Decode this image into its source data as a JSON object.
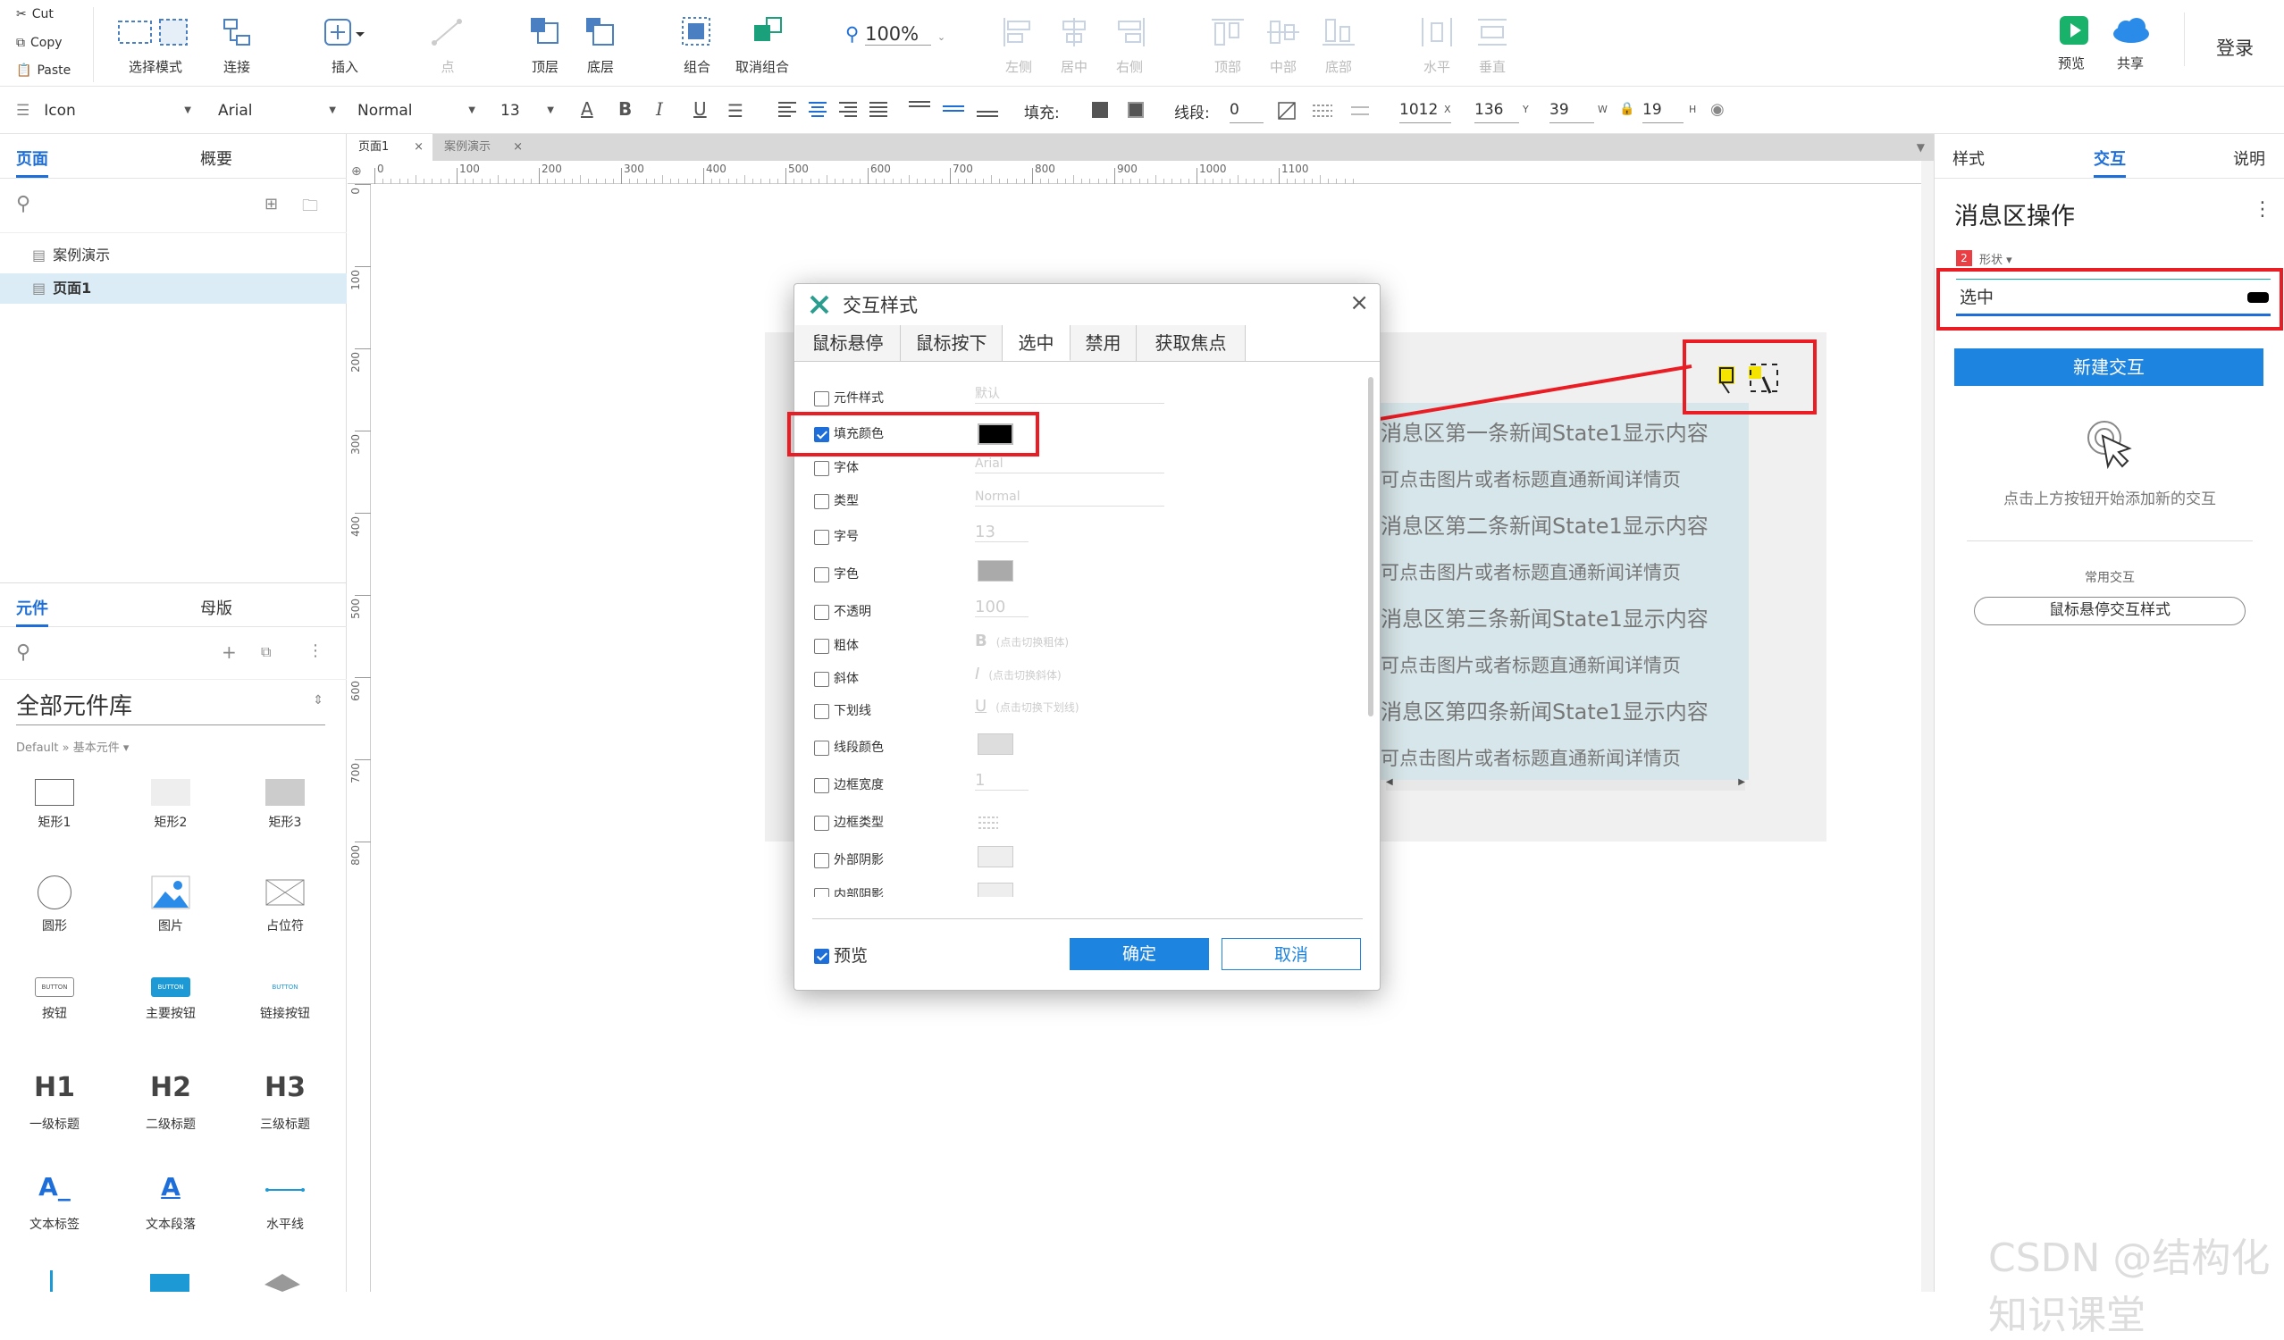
{
  "clipboard": {
    "cut": "Cut",
    "copy": "Copy",
    "paste": "Paste"
  },
  "toolbar": {
    "select_mode": "选择模式",
    "connect": "连接",
    "insert": "插入",
    "point": "点",
    "top_layer": "顶层",
    "bottom_layer": "底层",
    "group": "组合",
    "ungroup": "取消组合",
    "zoom": "100%",
    "align_left": "左侧",
    "align_center": "居中",
    "align_right": "右侧",
    "align_top": "顶部",
    "align_middle": "中部",
    "align_bottom": "底部",
    "dist_h": "水平",
    "dist_v": "垂直",
    "preview": "预览",
    "share": "共享",
    "login": "登录"
  },
  "format": {
    "style_name": "Icon",
    "font": "Arial",
    "weight": "Normal",
    "size": "13",
    "fill_label": "填充:",
    "line_label": "线段:",
    "line_value": "0",
    "x": "1012",
    "x_unit": "X",
    "y": "136",
    "y_unit": "Y",
    "w": "39",
    "w_unit": "W",
    "h": "19",
    "h_unit": "H"
  },
  "left": {
    "tab_pages": "页面",
    "tab_outline": "概要",
    "pages": [
      "案例演示",
      "页面1"
    ],
    "tab_widgets": "元件",
    "tab_masters": "母版",
    "library": "全部元件库",
    "library_path": "Default » 基本元件 ▾",
    "widgets": [
      {
        "name": "矩形1",
        "icon": "rect-outline-icon"
      },
      {
        "name": "矩形2",
        "icon": "rect-light-icon"
      },
      {
        "name": "矩形3",
        "icon": "rect-gray-icon"
      },
      {
        "name": "圆形",
        "icon": "circle-icon"
      },
      {
        "name": "图片",
        "icon": "image-icon"
      },
      {
        "name": "占位符",
        "icon": "placeholder-icon"
      },
      {
        "name": "按钮",
        "icon": "button-icon"
      },
      {
        "name": "主要按钮",
        "icon": "primary-button-icon"
      },
      {
        "name": "链接按钮",
        "icon": "link-button-icon"
      },
      {
        "name": "一级标题",
        "icon": "h1-icon"
      },
      {
        "name": "二级标题",
        "icon": "h2-icon"
      },
      {
        "name": "三级标题",
        "icon": "h3-icon"
      },
      {
        "name": "文本标签",
        "icon": "text-label-icon"
      },
      {
        "name": "文本段落",
        "icon": "text-paragraph-icon"
      },
      {
        "name": "水平线",
        "icon": "horizontal-line-icon"
      }
    ],
    "widget_glyphs": {
      "button": "BUTTON",
      "h1": "H1",
      "h2": "H2",
      "h3": "H3",
      "text_label": "A_",
      "text_para": "A"
    }
  },
  "doc_tabs": [
    "页面1",
    "案例演示"
  ],
  "ruler_h": [
    "0",
    "100",
    "200",
    "300",
    "400",
    "500",
    "600",
    "700",
    "800",
    "900",
    "1000",
    "1100"
  ],
  "ruler_v": [
    "0",
    "100",
    "200",
    "300",
    "400",
    "500",
    "600",
    "700",
    "800"
  ],
  "canvas": {
    "news": [
      "消息区第一条新闻State1显示内容",
      "可点击图片或者标题直通新闻详情页",
      "消息区第二条新闻State1显示内容",
      "可点击图片或者标题直通新闻详情页",
      "消息区第三条新闻State1显示内容",
      "可点击图片或者标题直通新闻详情页",
      "消息区第四条新闻State1显示内容",
      "可点击图片或者标题直通新闻详情页"
    ]
  },
  "dialog": {
    "title": "交互样式",
    "tabs": [
      "鼠标悬停",
      "鼠标按下",
      "选中",
      "禁用",
      "获取焦点"
    ],
    "active_tab": "选中",
    "rows": [
      {
        "label": "元件样式",
        "value": "默认",
        "checked": false
      },
      {
        "label": "填充颜色",
        "value": "",
        "checked": true
      },
      {
        "label": "字体",
        "value": "Arial",
        "checked": false
      },
      {
        "label": "类型",
        "value": "Normal",
        "checked": false
      },
      {
        "label": "字号",
        "value": "13",
        "checked": false
      },
      {
        "label": "字色",
        "value": "",
        "checked": false
      },
      {
        "label": "不透明",
        "value": "100",
        "checked": false
      },
      {
        "label": "粗体",
        "value": "(点击切换粗体)",
        "checked": false
      },
      {
        "label": "斜体",
        "value": "(点击切换斜体)",
        "checked": false
      },
      {
        "label": "下划线",
        "value": "(点击切换下划线)",
        "checked": false
      },
      {
        "label": "线段颜色",
        "value": "",
        "checked": false
      },
      {
        "label": "边框宽度",
        "value": "1",
        "checked": false
      },
      {
        "label": "边框类型",
        "value": "",
        "checked": false
      },
      {
        "label": "外部阴影",
        "value": "",
        "checked": false
      },
      {
        "label": "内部阴影",
        "value": "",
        "checked": false
      }
    ],
    "glyph_bold": "B",
    "glyph_italic": "I",
    "glyph_underline": "U",
    "preview": "预览",
    "ok": "确定",
    "cancel": "取消"
  },
  "right": {
    "tab_style": "样式",
    "tab_interact": "交互",
    "tab_notes": "说明",
    "title": "消息区操作",
    "badge": "2",
    "shape_label": "形状 ▾",
    "state_value": "选中",
    "new_interaction": "新建交互",
    "hint": "点击上方按钮开始添加新的交互",
    "common": "常用交互",
    "hover_style": "鼠标悬停交互样式"
  },
  "watermark": "CSDN @结构化知识课堂",
  "colors": {
    "accent": "#1d6ed8",
    "annotation": "#ea1c24",
    "news_bg": "#d7e6ea",
    "fill_black": "#000000"
  }
}
